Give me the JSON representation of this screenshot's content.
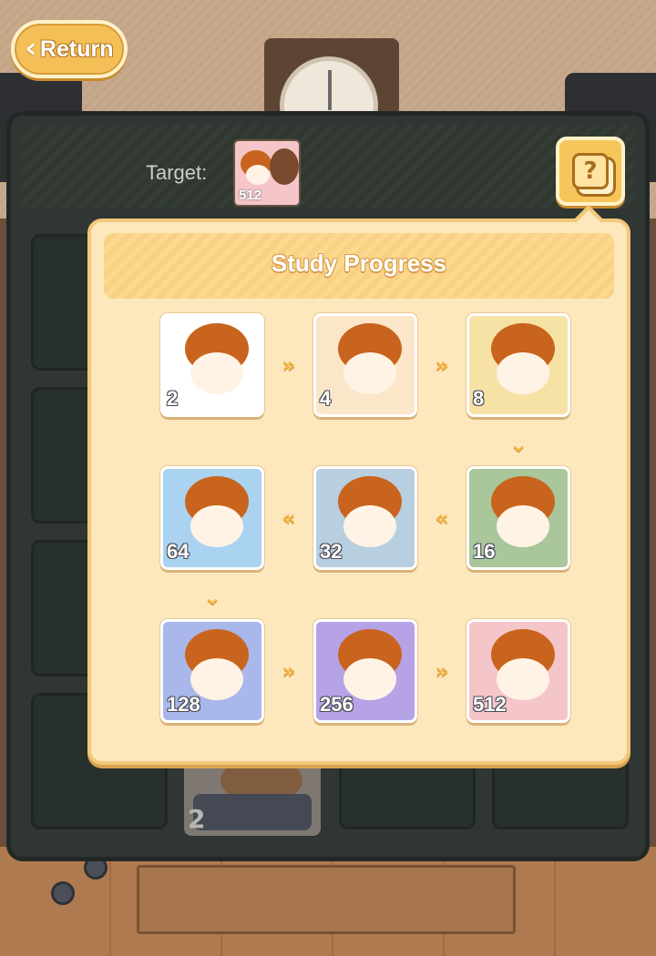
{
  "nav": {
    "return_label": "Return",
    "return_icon": "chevron-left-icon"
  },
  "board": {
    "target_label": "Target:",
    "target_value": "512"
  },
  "help": {
    "icon": "question-icon",
    "symbol": "?"
  },
  "panel": {
    "title": "Study Progress",
    "stages": [
      {
        "value": "2",
        "bg": "#ffffff"
      },
      {
        "value": "4",
        "bg": "#fbe6c9"
      },
      {
        "value": "8",
        "bg": "#f7e2a6"
      },
      {
        "value": "16",
        "bg": "#a9c79a"
      },
      {
        "value": "32",
        "bg": "#b8cfe0"
      },
      {
        "value": "64",
        "bg": "#a9d3f0"
      },
      {
        "value": "128",
        "bg": "#a9b7ea"
      },
      {
        "value": "256",
        "bg": "#b6a3e6"
      },
      {
        "value": "512",
        "bg": "#f5c6c9"
      }
    ]
  },
  "ghost_tile": {
    "value": "2"
  },
  "colors": {
    "accent": "#f4bf57",
    "panel": "#fde7bd",
    "board": "#2f3633",
    "hair": "#c8641d"
  }
}
